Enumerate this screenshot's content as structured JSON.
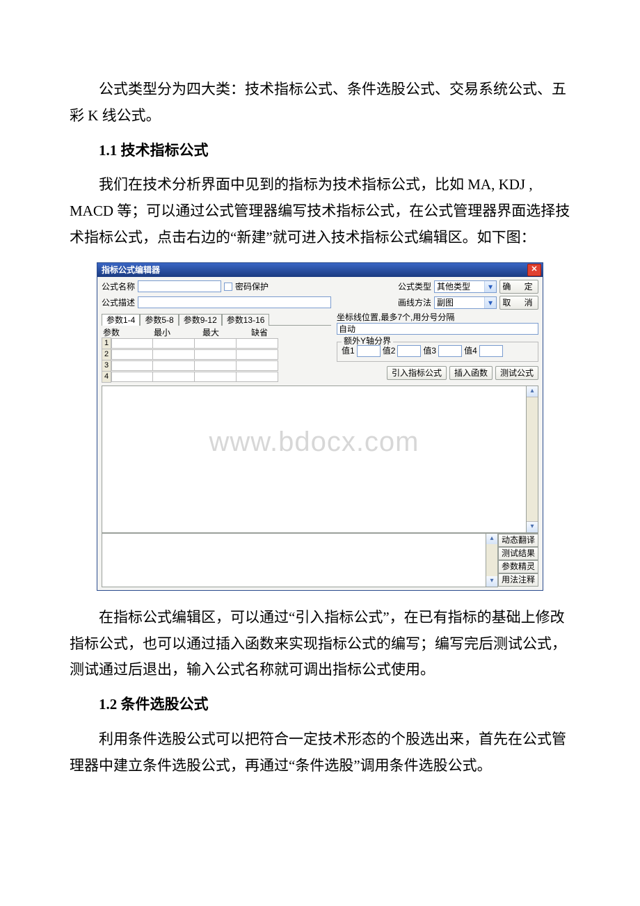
{
  "doc": {
    "intro": "公式类型分为四大类：技术指标公式、条件选股公式、交易系统公式、五彩 K 线公式。",
    "h1": "1.1 技术指标公式",
    "p1": "我们在技术分析界面中见到的指标为技术指标公式，比如 MA, KDJ , MACD 等；可以通过公式管理器编写技术指标公式，在公式管理器界面选择技术指标公式，点击右边的“新建”就可进入技术指标公式编辑区。如下图：",
    "after1": "在指标公式编辑区，可以通过“引入指标公式”，在已有指标的基础上修改指标公式，也可以通过插入函数来实现指标公式的编写；编写完后测试公式，测试通过后退出，输入公式名称就可调出指标公式使用。",
    "h2": "1.2 条件选股公式",
    "p2": "利用条件选股公式可以把符合一定技术形态的个股选出来，首先在公式管理器中建立条件选股公式，再通过“条件选股”调用条件选股公式。"
  },
  "window": {
    "title": "指标公式编辑器",
    "name_label": "公式名称",
    "desc_label": "公式描述",
    "pwd_label": "密码保护",
    "type_label": "公式类型",
    "type_value": "其他类型",
    "draw_label": "画线方法",
    "draw_value": "副图",
    "ok": "确 定",
    "cancel": "取 消",
    "tabs": [
      "参数1-4",
      "参数5-8",
      "参数9-12",
      "参数13-16"
    ],
    "param_headers": [
      "参数",
      "最小",
      "最大",
      "缺省"
    ],
    "param_rows": [
      "1",
      "2",
      "3",
      "4"
    ],
    "coord_label": "坐标线位置,最多7个,用分号分隔",
    "coord_value": "自动",
    "extra_y_legend": "额外Y轴分界",
    "val_labels": [
      "值1",
      "值2",
      "值3",
      "值4"
    ],
    "import_btn": "引入指标公式",
    "insert_btn": "插入函数",
    "test_btn": "测试公式",
    "side_buttons": [
      "动态翻译",
      "测试结果",
      "参数精灵",
      "用法注释"
    ],
    "watermark": "www.bdocx.com"
  }
}
